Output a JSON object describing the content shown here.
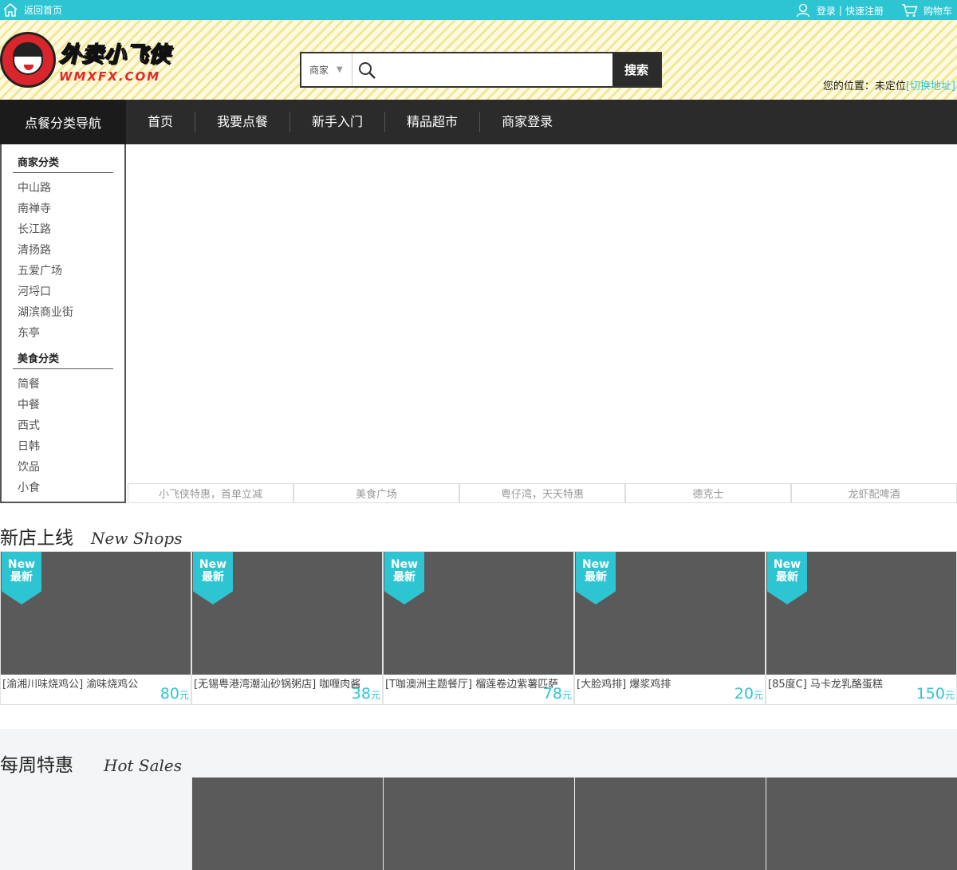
{
  "topbar": {
    "home": "返回首页",
    "login": "登录",
    "sep": "|",
    "register": "快速注册",
    "cart": "购物车"
  },
  "logo": {
    "cn": "外卖小飞侠",
    "en": "WMXFX.COM"
  },
  "search": {
    "scope": "商家",
    "placeholder": "",
    "button": "搜索"
  },
  "location": {
    "label": "您的位置：未定位",
    "link": "[切换地址]"
  },
  "nav": {
    "category": "点餐分类导航",
    "items": [
      "首页",
      "我要点餐",
      "新手入门",
      "精品超市",
      "商家登录"
    ]
  },
  "sidebar": {
    "merchant_title": "商家分类",
    "merchants": [
      "中山路",
      "南禅寺",
      "长江路",
      "清扬路",
      "五爱广场",
      "河埒口",
      "湖滨商业街",
      "东亭"
    ],
    "food_title": "美食分类",
    "foods": [
      "简餐",
      "中餐",
      "西式",
      "日韩",
      "饮品",
      "小食"
    ]
  },
  "banner_tabs": [
    "小飞侠特惠，首单立减",
    "美食广场",
    "粤仔湾，天天特惠",
    "德克士",
    "龙虾配啤酒"
  ],
  "new_shops": {
    "title": "新店上线",
    "subtitle": "New Shops",
    "ribbon_en": "New",
    "ribbon_cn": "最新",
    "currency": "元",
    "items": [
      {
        "name": "[渝湘川味烧鸡公] 渝味烧鸡公",
        "price": "80"
      },
      {
        "name": "[无锡粤港湾潮汕砂锅粥店] 咖喱肉酱",
        "price": "38"
      },
      {
        "name": "[T咖澳洲主题餐厅] 榴莲卷边紫薯匹萨",
        "price": "78"
      },
      {
        "name": "[大脸鸡排] 爆浆鸡排",
        "price": "20"
      },
      {
        "name": "[85度C] 马卡龙乳酪蛋糕",
        "price": "150"
      }
    ]
  },
  "hot_sales": {
    "title": "每周特惠",
    "subtitle": "Hot Sales"
  },
  "colors": {
    "accent": "#2ec5d3",
    "dark": "#2b2b2b",
    "placeholder_img": "#5b5a5b"
  }
}
